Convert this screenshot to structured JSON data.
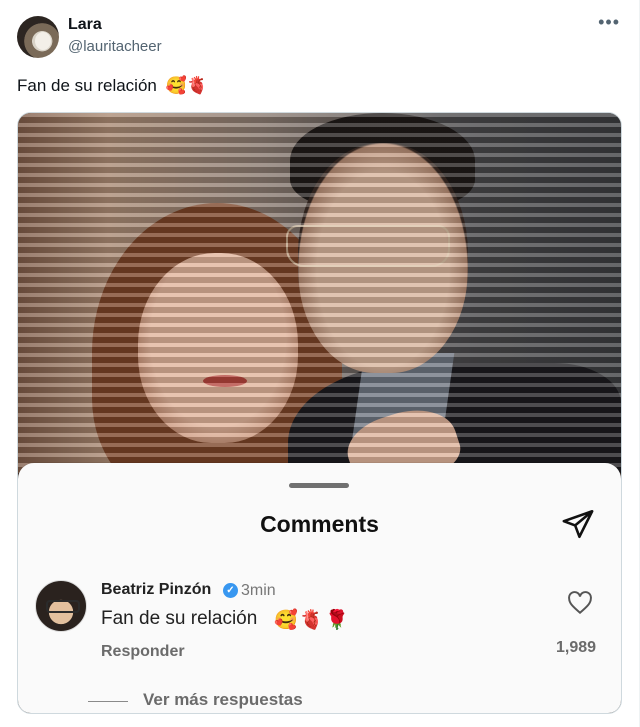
{
  "author": {
    "name": "Lara",
    "handle": "@lauritacheer"
  },
  "tweet": {
    "text": "Fan de su relación",
    "emojis": "🥰🫀"
  },
  "more_icon": "more-horizontal-icon",
  "comments_sheet": {
    "title": "Comments",
    "send_icon": "send-icon",
    "comment": {
      "author": "Beatriz Pinzón",
      "verified_icon": "verified-badge-icon",
      "time": "3min",
      "text": "Fan de su relación",
      "emojis": "🥰🫀🌹",
      "reply_label": "Responder",
      "like_icon": "heart-icon",
      "likes": "1,989"
    },
    "more_replies": "Ver más respuestas"
  }
}
